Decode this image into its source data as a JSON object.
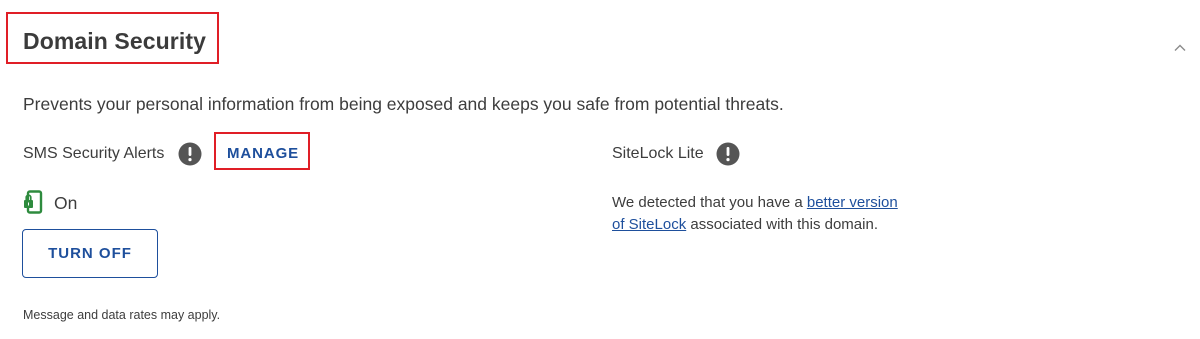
{
  "section": {
    "title": "Domain Security",
    "description": "Prevents your personal information from being exposed and keeps you safe from potential threats.",
    "collapse_icon": "chevron-up-icon"
  },
  "sms_alerts": {
    "label": "SMS Security Alerts",
    "info_icon": "exclamation-circle-icon",
    "manage_label": "MANAGE",
    "status_icon": "phone-lock-icon",
    "status": "On",
    "turn_off_label": "TURN OFF",
    "disclaimer": "Message and data rates may apply."
  },
  "sitelock": {
    "label": "SiteLock Lite",
    "info_icon": "exclamation-circle-icon",
    "message_prefix": "We detected that you have a ",
    "message_link": "better version of SiteLock",
    "message_suffix": " associated with this domain."
  },
  "colors": {
    "link_blue": "#1e4f9c",
    "highlight_red": "#e01e26",
    "status_green": "#2e8b3e",
    "info_gray": "#555555"
  }
}
